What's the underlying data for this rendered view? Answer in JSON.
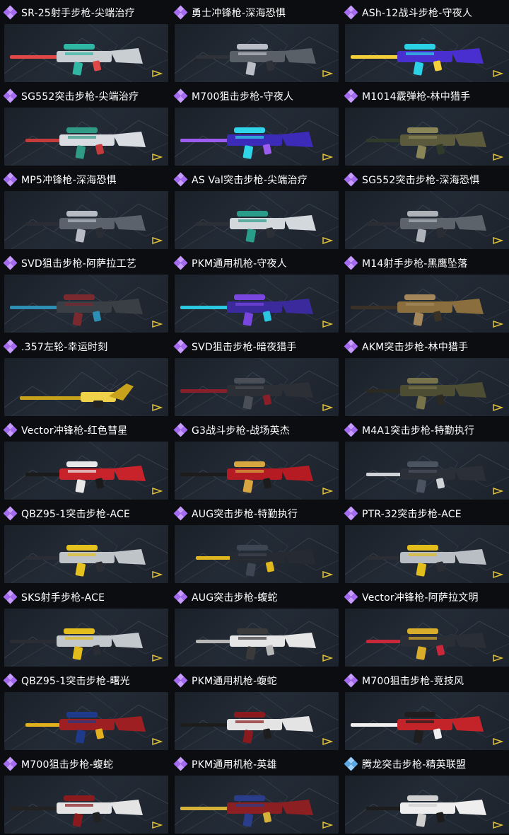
{
  "items": [
    {
      "name": "SR-25射手步枪-尖端治疗",
      "rarity": "purple",
      "body": "#c9ced3",
      "accent": "#2fb7a3",
      "trim": "#e04848"
    },
    {
      "name": "勇士冲锋枪-深海恐惧",
      "rarity": "purple",
      "body": "#5a6068",
      "accent": "#b9bec6",
      "trim": "#2e3238"
    },
    {
      "name": "ASh-12战斗步枪-守夜人",
      "rarity": "purple",
      "body": "#4a2fd0",
      "accent": "#2bd1e6",
      "trim": "#f3d03a"
    },
    {
      "name": "SG552突击步枪-尖端治疗",
      "rarity": "purple",
      "body": "#d9dde1",
      "accent": "#2f9a86",
      "trim": "#c53a3a"
    },
    {
      "name": "M700狙击步枪-守夜人",
      "rarity": "purple",
      "body": "#3b2bb8",
      "accent": "#2fd5e8",
      "trim": "#9d5cf0"
    },
    {
      "name": "M1014霰弹枪-林中猎手",
      "rarity": "purple",
      "body": "#5c5a3c",
      "accent": "#8a8556",
      "trim": "#2f3a2a"
    },
    {
      "name": "MP5冲锋枪-深海恐惧",
      "rarity": "purple",
      "body": "#5c626b",
      "accent": "#b7bcc4",
      "trim": "#2a2d33"
    },
    {
      "name": "AS Val突击步枪-尖端治疗",
      "rarity": "purple",
      "body": "#d3d8dc",
      "accent": "#2a9d8a",
      "trim": "#2b3036"
    },
    {
      "name": "SG552突击步枪-深海恐惧",
      "rarity": "purple",
      "body": "#5d636b",
      "accent": "#aeb3ba",
      "trim": "#2a2d33"
    },
    {
      "name": "SVD狙击步枪-阿萨拉工艺",
      "rarity": "purple",
      "body": "#3a3f46",
      "accent": "#7a2a2e",
      "trim": "#2e8fb5"
    },
    {
      "name": "PKM通用机枪-守夜人",
      "rarity": "purple",
      "body": "#3a2a9c",
      "accent": "#7a46e0",
      "trim": "#2bc6df"
    },
    {
      "name": "M14射手步枪-黑鹰坠落",
      "rarity": "purple",
      "body": "#8a6e3e",
      "accent": "#a3875a",
      "trim": "#3a3226"
    },
    {
      "name": ".357左轮-幸运时刻",
      "rarity": "purple",
      "body": "#c9a21c",
      "accent": "#f0d24a",
      "trim": "#222"
    },
    {
      "name": "SVD狙击步枪-暗夜猎手",
      "rarity": "purple",
      "body": "#2c2f35",
      "accent": "#4a4e56",
      "trim": "#8a1f2a"
    },
    {
      "name": "AKM突击步枪-林中猎手",
      "rarity": "purple",
      "body": "#4d4d33",
      "accent": "#77724a",
      "trim": "#2a2a22"
    },
    {
      "name": "Vector冲锋枪-红色彗星",
      "rarity": "purple",
      "body": "#c8222a",
      "accent": "#e8e8e8",
      "trim": "#1b1b1b"
    },
    {
      "name": "G3战斗步枪-战场英杰",
      "rarity": "purple",
      "body": "#b51b22",
      "accent": "#d8a640",
      "trim": "#1c1c1c"
    },
    {
      "name": "M4A1突击步枪-特勤执行",
      "rarity": "purple",
      "body": "#2a2f38",
      "accent": "#4b5260",
      "trim": "#cfd3d8"
    },
    {
      "name": "QBZ95-1突击步枪-ACE",
      "rarity": "purple",
      "body": "#bfc4c9",
      "accent": "#e6c21e",
      "trim": "#2a2d33"
    },
    {
      "name": "AUG突击步枪-特勤执行",
      "rarity": "purple",
      "body": "#262b33",
      "accent": "#3e4553",
      "trim": "#e0b81e"
    },
    {
      "name": "PTR-32突击步枪-ACE",
      "rarity": "purple",
      "body": "#b9bec4",
      "accent": "#e2bd1c",
      "trim": "#2a2d33"
    },
    {
      "name": "SKS射手步枪-ACE",
      "rarity": "purple",
      "body": "#c3c8cd",
      "accent": "#e2bd1c",
      "trim": "#2a2d33"
    },
    {
      "name": "AUG突击步枪-蝮蛇",
      "rarity": "purple",
      "body": "#e6e6e6",
      "accent": "#3a3a3a",
      "trim": "#b7b7b7"
    },
    {
      "name": "Vector冲锋枪-阿萨拉文明",
      "rarity": "purple",
      "body": "#2a2e36",
      "accent": "#d8ad2c",
      "trim": "#c8283a"
    },
    {
      "name": "QBZ95-1突击步枪-曙光",
      "rarity": "purple",
      "body": "#9e1f22",
      "accent": "#1f3a8a",
      "trim": "#e3b11e"
    },
    {
      "name": "PKM通用机枪-蝮蛇",
      "rarity": "purple",
      "body": "#e4e4e4",
      "accent": "#8a1a1d",
      "trim": "#1d1d1d"
    },
    {
      "name": "M700狙击步枪-竞技风",
      "rarity": "purple",
      "body": "#c3242a",
      "accent": "#1e1e1e",
      "trim": "#f0f0f0"
    },
    {
      "name": "M700狙击步枪-蝮蛇",
      "rarity": "purple",
      "body": "#e4e4e4",
      "accent": "#8a1a1d",
      "trim": "#222"
    },
    {
      "name": "PKM通用机枪-英雄",
      "rarity": "purple",
      "body": "#8c1f22",
      "accent": "#2a3d8a",
      "trim": "#d6b13a"
    },
    {
      "name": "腾龙突击步枪-精英联盟",
      "rarity": "blue",
      "body": "#eeeeee",
      "accent": "#cfcfcf",
      "trim": "#1c1c1c"
    }
  ],
  "colors": {
    "purple": "#a46bf2",
    "purple_light": "#c79bff",
    "blue": "#5aa7e6",
    "blue_light": "#9cd0ff",
    "background": "#0c0d10"
  }
}
